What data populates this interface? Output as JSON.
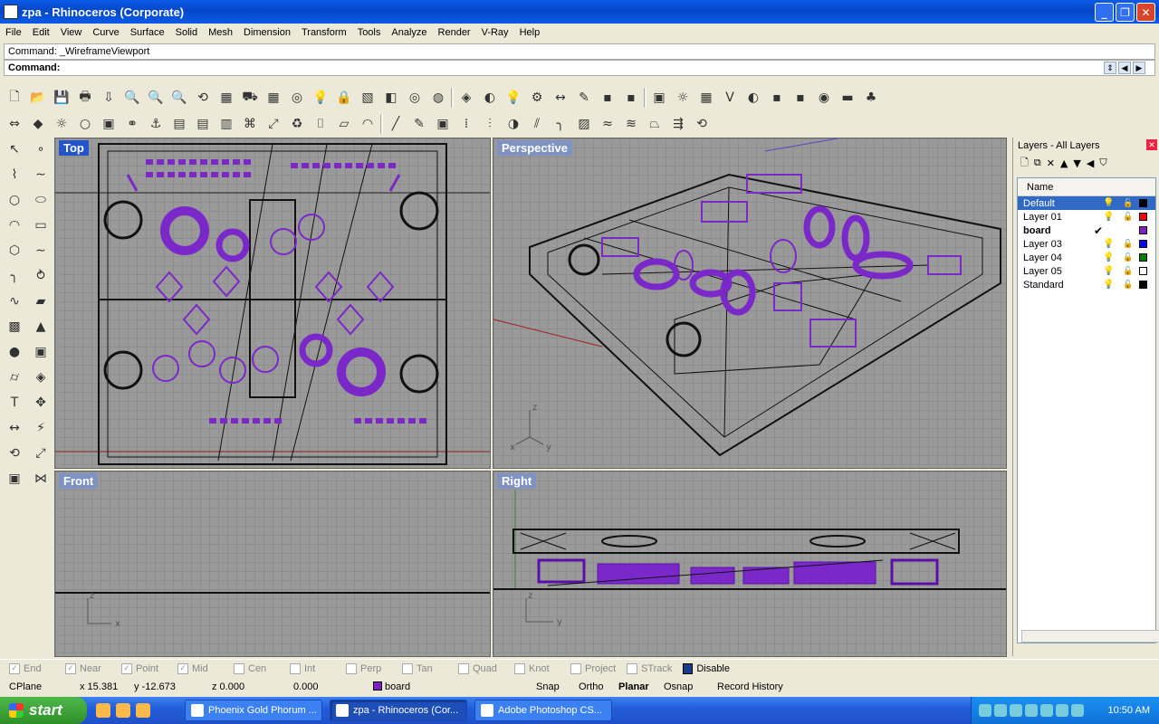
{
  "window": {
    "title": "zpa - Rhinoceros (Corporate)",
    "min": "_",
    "max": "❐",
    "close": "✕"
  },
  "menu": [
    "File",
    "Edit",
    "View",
    "Curve",
    "Surface",
    "Solid",
    "Mesh",
    "Dimension",
    "Transform",
    "Tools",
    "Analyze",
    "Render",
    "V-Ray",
    "Help"
  ],
  "command": {
    "history": "Command: _WireframeViewport",
    "prompt_label": "Command:",
    "value": ""
  },
  "toolbar1_icons": [
    "new-icon",
    "open-icon",
    "save-icon",
    "print-icon",
    "import-icon",
    "zoom-window-icon",
    "zoom-extents-icon",
    "zoom-icon",
    "rotate-view-icon",
    "four-viewports-icon",
    "car-icon",
    "grid-icon",
    "osnap-icon",
    "lightbulb-icon",
    "lock-icon",
    "properties-icon",
    "material-icon",
    "color-wheel-icon",
    "wireframe-sphere-icon",
    "mesh-sphere-icon",
    "render-sphere-icon",
    "light-icon",
    "gear-icon",
    "dimension-icon",
    "tag-icon",
    "tag2-icon",
    "tag3-icon",
    "box-icon",
    "sun-icon",
    "texture-icon",
    "vray-icon",
    "render-icon",
    "render2-icon",
    "render3-icon",
    "globe-icon",
    "environment-icon",
    "tree-icon"
  ],
  "toolbar2_icons": [
    "move-icon",
    "diamond-icon",
    "sun-icon",
    "circle-icon",
    "cube-icon",
    "link-icon",
    "hook-icon",
    "calendar-icon",
    "sheet-icon",
    "document-icon",
    "network-icon",
    "scale-icon",
    "recycle-icon",
    "camera-icon",
    "plane-icon",
    "arc-icon",
    "line-icon",
    "edit-icon",
    "box-icon",
    "array-icon",
    "align-icon",
    "boolean-icon",
    "split-icon",
    "fillet-icon",
    "loft-icon",
    "sweep-icon",
    "twist-icon",
    "taper-icon",
    "flow-icon",
    "rotate-3d-icon"
  ],
  "left_tools": [
    "select-icon",
    "point-icon",
    "polyline-icon",
    "curve-pts-icon",
    "circle-icon",
    "ellipse-icon",
    "arc-icon",
    "rectangle-icon",
    "polygon-icon",
    "free-curve-icon",
    "fillet-icon",
    "offset-icon",
    "blend-icon",
    "surface-icon",
    "patch-icon",
    "extrude-icon",
    "sphere-icon",
    "box-icon",
    "cylinder-icon",
    "mesh-icon",
    "text-icon",
    "transform-icon",
    "dimension-icon",
    "analyze-icon",
    "rotate-icon",
    "scale-icon",
    "solid-icon",
    "join-icon"
  ],
  "viewports": {
    "top": "Top",
    "perspective": "Perspective",
    "front": "Front",
    "right": "Right"
  },
  "layers_panel": {
    "title": "Layers - All Layers",
    "col_name": "Name",
    "layers": [
      {
        "name": "Default",
        "color": "#000000",
        "selected": true
      },
      {
        "name": "Layer 01",
        "color": "#ff0000"
      },
      {
        "name": "board",
        "color": "#8020c0",
        "current": true,
        "check": "✔"
      },
      {
        "name": "Layer 03",
        "color": "#0000ff"
      },
      {
        "name": "Layer 04",
        "color": "#008000"
      },
      {
        "name": "Layer 05",
        "color": "#ffffff"
      },
      {
        "name": "Standard",
        "color": "#000000"
      }
    ]
  },
  "osnap": [
    {
      "label": "End",
      "checked": true
    },
    {
      "label": "Near",
      "checked": true
    },
    {
      "label": "Point",
      "checked": true
    },
    {
      "label": "Mid",
      "checked": true
    },
    {
      "label": "Cen",
      "checked": false
    },
    {
      "label": "Int",
      "checked": false
    },
    {
      "label": "Perp",
      "checked": false
    },
    {
      "label": "Tan",
      "checked": false
    },
    {
      "label": "Quad",
      "checked": false
    },
    {
      "label": "Knot",
      "checked": false
    },
    {
      "label": "Project",
      "checked": false
    },
    {
      "label": "STrack",
      "checked": false
    },
    {
      "label": "Disable",
      "checked": true
    }
  ],
  "status": {
    "cplane": "CPlane",
    "x": "x 15.381",
    "y": "y -12.673",
    "z": "z 0.000",
    "extra": "0.000",
    "layer": "board",
    "snap": "Snap",
    "ortho": "Ortho",
    "planar": "Planar",
    "osnap": "Osnap",
    "history": "Record History"
  },
  "taskbar": {
    "start": "start",
    "tasks": [
      "Phoenix Gold Phorum ...",
      "zpa - Rhinoceros (Cor...",
      "Adobe Photoshop CS..."
    ],
    "clock": "10:50 AM"
  },
  "colors": {
    "accent": "#8020c0",
    "viewport_bg": "#9a9a9a",
    "titlebar": "#0a5be6"
  }
}
